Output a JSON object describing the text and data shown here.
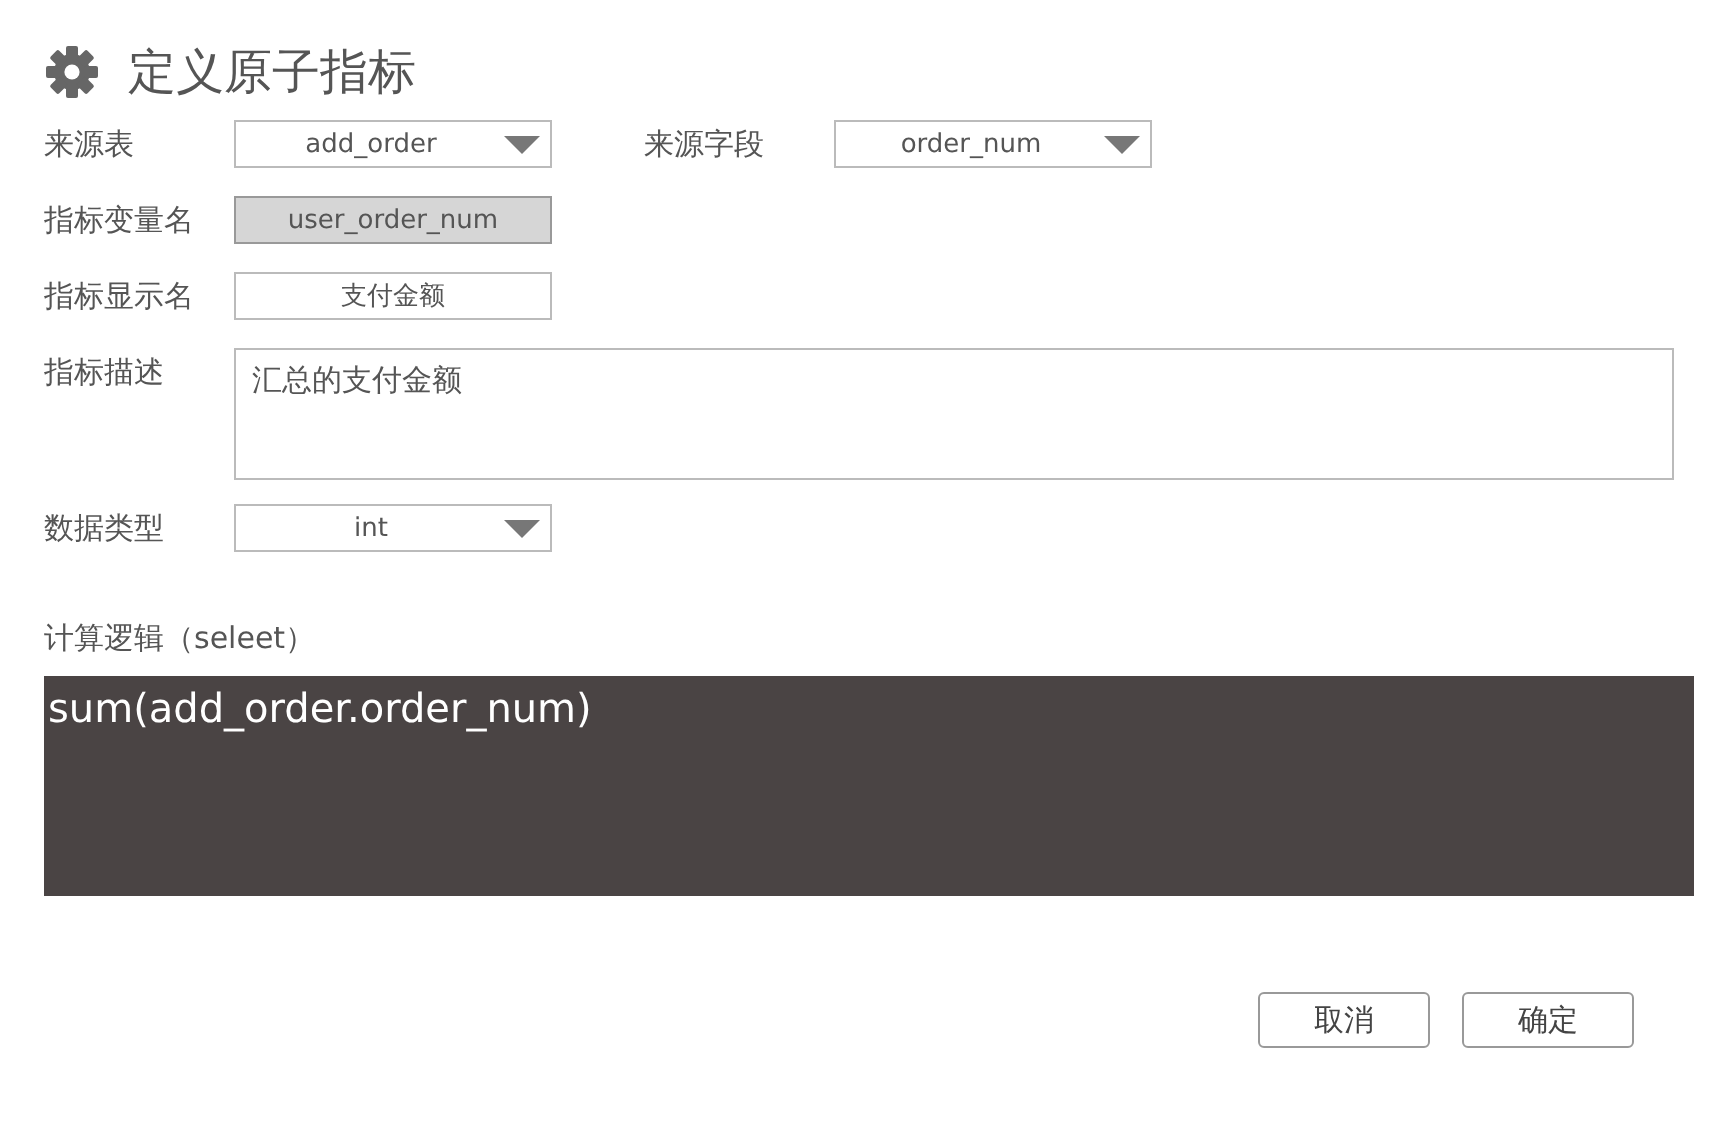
{
  "title": "定义原子指标",
  "rows": [
    {
      "fields": [
        {
          "label": "来源表",
          "kind": "select",
          "value": "add_order"
        },
        {
          "label": "来源字段",
          "kind": "select",
          "value": "order_num"
        }
      ]
    },
    {
      "fields": [
        {
          "label": "指标变量名",
          "kind": "readonly",
          "value": "user_order_num"
        }
      ]
    },
    {
      "fields": [
        {
          "label": "指标显示名",
          "kind": "text",
          "value": "支付金额"
        }
      ]
    },
    {
      "fields": [
        {
          "label": "指标描述",
          "kind": "textarea",
          "value": "汇总的支付金额"
        }
      ]
    },
    {
      "fields": [
        {
          "label": "数据类型",
          "kind": "select",
          "value": "int"
        }
      ]
    }
  ],
  "logic": {
    "label": "计算逻辑（seleet）",
    "code": "sum(add_order.order_num)"
  },
  "buttons": [
    "取消",
    "确定"
  ]
}
